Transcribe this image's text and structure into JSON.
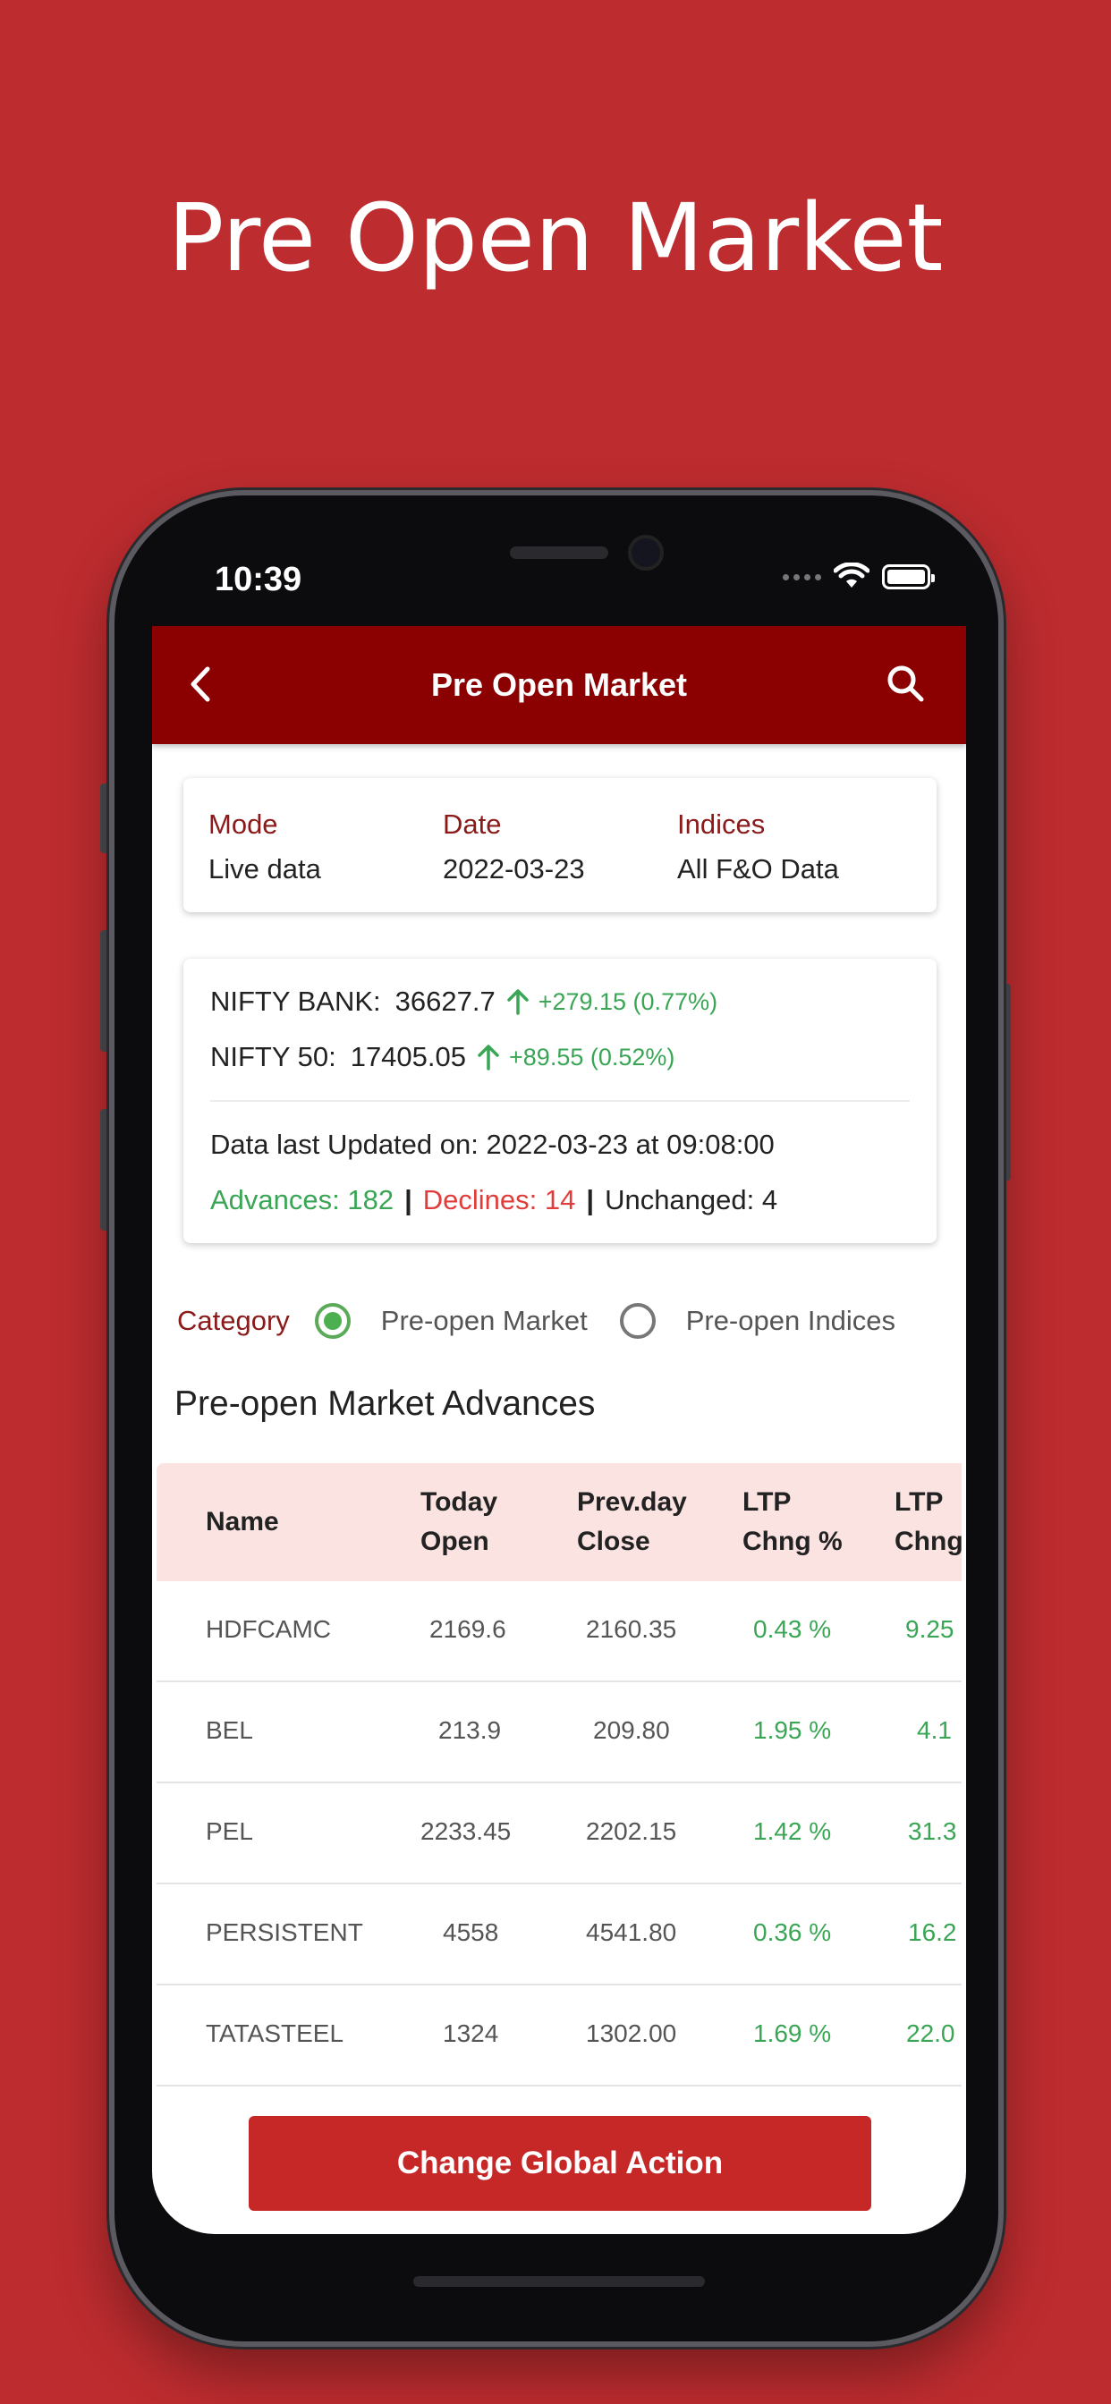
{
  "promo": {
    "headline": "Pre Open Market"
  },
  "status_bar": {
    "time": "10:39"
  },
  "app_bar": {
    "title": "Pre Open Market",
    "back_icon": "chevron-left-icon",
    "search_icon": "search-icon"
  },
  "mode_card": {
    "mode_label": "Mode",
    "mode_value": "Live data",
    "date_label": "Date",
    "date_value": "2022-03-23",
    "indices_label": "Indices",
    "indices_value": "All F&O Data"
  },
  "index_card": {
    "nifty_bank_label": "NIFTY BANK:",
    "nifty_bank_value": "36627.7",
    "nifty_bank_change": "+279.15 (0.77%)",
    "nifty50_label": "NIFTY 50:",
    "nifty50_value": "17405.05",
    "nifty50_change": "+89.55 (0.52%)",
    "updated_text": "Data last Updated on: 2022-03-23 at 09:08:00",
    "advances": "Advances: 182",
    "declines": "Declines: 14",
    "unchanged": "Unchanged: 4"
  },
  "category": {
    "label": "Category",
    "option1": "Pre-open Market",
    "option1_selected": true,
    "option2": "Pre-open Indices",
    "option2_selected": false
  },
  "section_title": "Pre-open Market Advances",
  "table": {
    "headers": {
      "name": "Name",
      "today_open_1": "Today",
      "today_open_2": "Open",
      "prev_close_1": "Prev.day",
      "prev_close_2": "Close",
      "ltp_chng_pct_1": "LTP",
      "ltp_chng_pct_2": "Chng %",
      "ltp_chng_1": "LTP",
      "ltp_chng_2": "Chng"
    },
    "rows": [
      {
        "name": "HDFCAMC",
        "open": "2169.6",
        "close": "2160.35",
        "pct": "0.43 %",
        "chng": "9.25"
      },
      {
        "name": "BEL",
        "open": "213.9",
        "close": "209.80",
        "pct": "1.95 %",
        "chng": "4.1"
      },
      {
        "name": "PEL",
        "open": "2233.45",
        "close": "2202.15",
        "pct": "1.42 %",
        "chng": "31.3"
      },
      {
        "name": "PERSISTENT",
        "open": "4558",
        "close": "4541.80",
        "pct": "0.36 %",
        "chng": "16.2"
      },
      {
        "name": "TATASTEEL",
        "open": "1324",
        "close": "1302.00",
        "pct": "1.69 %",
        "chng": "22.0"
      }
    ]
  },
  "action_button": "Change Global Action",
  "colors": {
    "background": "#bd2c2f",
    "app_bar": "#8b0000",
    "positive": "#3aa655",
    "negative": "#e03c3c",
    "header_row": "#fbe3e2",
    "button": "#c62828"
  }
}
